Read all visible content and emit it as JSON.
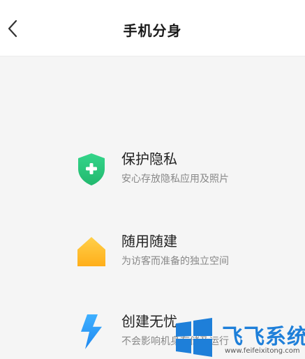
{
  "header": {
    "title": "手机分身"
  },
  "features": [
    {
      "title": "保护隐私",
      "desc": "安心存放隐私应用及照片",
      "icon": "shield-plus-icon",
      "color": "#2ecf7f"
    },
    {
      "title": "随用随建",
      "desc": "为访客而准备的独立空间",
      "icon": "house-icon",
      "color": "#ffbe2e"
    },
    {
      "title": "创建无忧",
      "desc": "不会影响机身存储及运行",
      "icon": "lightning-icon",
      "color": "#2a9cff"
    }
  ],
  "watermark": {
    "text": "飞飞系统",
    "url": "www.feifeixitong.com"
  }
}
